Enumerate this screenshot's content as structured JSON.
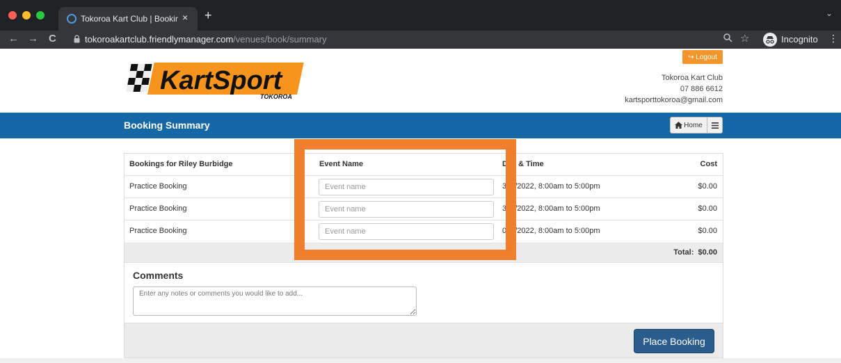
{
  "browser": {
    "tab_title": "Tokoroa Kart Club | Booking Su",
    "tab_close": "×",
    "new_tab": "+",
    "tab_menu": "⌄",
    "nav_back": "←",
    "nav_forward": "→",
    "nav_reload": "C",
    "url_host": "tokoroakartclub.friendlymanager.com",
    "url_path": "/venues/book/summary",
    "incognito_label": "Incognito",
    "star": "☆",
    "kebab": "⋮",
    "colors": {
      "close": "#ff5f57",
      "minimize": "#febc2e",
      "maximize": "#28c840"
    }
  },
  "header": {
    "logout_label": "Logout",
    "logo_text": "KartSport",
    "logo_subtext": "TOKOROA",
    "club_name": "Tokoroa Kart Club",
    "phone": "07 886 6612",
    "email": "kartsporttokoroa@gmail.com"
  },
  "banner": {
    "title": "Booking Summary",
    "home_label": "Home",
    "color": "#1468a6"
  },
  "table": {
    "headers": {
      "bookings": "Bookings for Riley Burbidge",
      "event": "Event Name",
      "date": "e & Time",
      "date_prefix": "D",
      "cost": "Cost"
    },
    "rows": [
      {
        "name": "Practice Booking",
        "event_placeholder": "Event name",
        "date_prefix": "3",
        "date": "3/2022, 8:00am to 5:00pm",
        "cost": "$0.00"
      },
      {
        "name": "Practice Booking",
        "event_placeholder": "Event name",
        "date_prefix": "3",
        "date": "3/2022, 8:00am to 5:00pm",
        "cost": "$0.00"
      },
      {
        "name": "Practice Booking",
        "event_placeholder": "Event name",
        "date_prefix": "0",
        "date": "4/2022, 8:00am to 5:00pm",
        "cost": "$0.00"
      }
    ],
    "total": "Total:  $0.00"
  },
  "comments": {
    "title": "Comments",
    "placeholder": "Enter any notes or comments you would like to add..."
  },
  "actions": {
    "place_booking": "Place Booking",
    "highlight_color": "#f07f2e"
  }
}
